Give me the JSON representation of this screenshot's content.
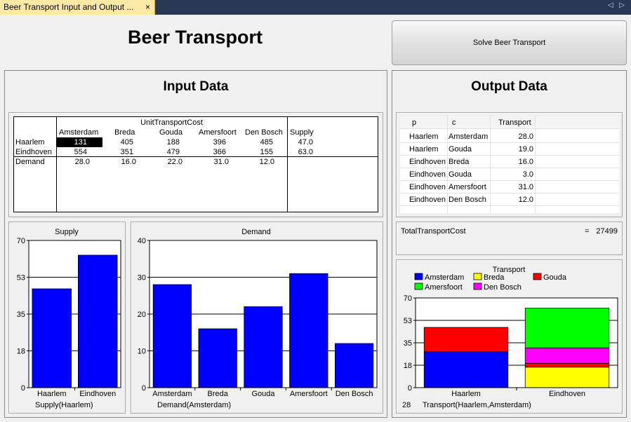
{
  "tab": {
    "title": "Beer Transport Input and Output ...",
    "close": "×",
    "nav": "◁ ▷"
  },
  "app_title": "Beer Transport",
  "solve_button": "Solve Beer Transport",
  "input_panel": {
    "title": "Input Data",
    "cost_header": "UnitTransportCost",
    "supply_header": "Supply",
    "destinations": [
      "Amsterdam",
      "Breda",
      "Gouda",
      "Amersfoort",
      "Den Bosch"
    ],
    "rows": [
      {
        "name": "Haarlem",
        "costs": [
          "131",
          "405",
          "188",
          "396",
          "485"
        ],
        "supply": "47.0"
      },
      {
        "name": "Eindhoven",
        "costs": [
          "554",
          "351",
          "479",
          "366",
          "155"
        ],
        "supply": "63.0"
      }
    ],
    "demand_label": "Demand",
    "demand": [
      "28.0",
      "16.0",
      "22.0",
      "31.0",
      "12.0"
    ]
  },
  "output_panel": {
    "title": "Output Data",
    "columns": [
      "p",
      "c",
      "Transport"
    ],
    "rows": [
      [
        "Haarlem",
        "Amsterdam",
        "28.0"
      ],
      [
        "Haarlem",
        "Gouda",
        "19.0"
      ],
      [
        "Eindhoven",
        "Breda",
        "16.0"
      ],
      [
        "Eindhoven",
        "Gouda",
        "3.0"
      ],
      [
        "Eindhoven",
        "Amersfoort",
        "31.0"
      ],
      [
        "Eindhoven",
        "Den Bosch",
        "12.0"
      ]
    ],
    "total_label": "TotalTransportCost",
    "total_eq": "=",
    "total_value": "27499"
  },
  "colors": {
    "bar": "#0000ff",
    "amsterdam": "#0000ff",
    "breda": "#ffff00",
    "gouda": "#ff0000",
    "amersfoort": "#00ff00",
    "den_bosch": "#ff00ff",
    "selection": "#000000"
  },
  "chart_data": [
    {
      "type": "bar",
      "title": "Supply",
      "categories": [
        "Haarlem",
        "Eindhoven"
      ],
      "values": [
        47,
        63
      ],
      "ylim": [
        0,
        70
      ],
      "yticks": [
        "0",
        "18",
        "35",
        "53",
        "70"
      ],
      "footer": "Supply(Haarlem)",
      "grid": true
    },
    {
      "type": "bar",
      "title": "Demand",
      "categories": [
        "Amsterdam",
        "Breda",
        "Gouda",
        "Amersfoort",
        "Den Bosch"
      ],
      "values": [
        28,
        16,
        22,
        31,
        12
      ],
      "ylim": [
        0,
        40
      ],
      "yticks": [
        "0",
        "10",
        "20",
        "30",
        "40"
      ],
      "footer": "Demand(Amsterdam)",
      "grid": true
    },
    {
      "type": "bar",
      "stacked": true,
      "title": "Transport",
      "categories": [
        "Haarlem",
        "Eindhoven"
      ],
      "series": [
        {
          "name": "Amsterdam",
          "values": [
            28,
            0
          ]
        },
        {
          "name": "Breda",
          "values": [
            0,
            16
          ]
        },
        {
          "name": "Gouda",
          "values": [
            19,
            3
          ]
        },
        {
          "name": "Amersfoort",
          "values": [
            0,
            31
          ]
        },
        {
          "name": "Den Bosch",
          "values": [
            0,
            12
          ]
        }
      ],
      "ylim": [
        0,
        70
      ],
      "yticks": [
        "0",
        "18",
        "35",
        "53",
        "70"
      ],
      "legend": "top",
      "footer_value": "28",
      "footer": "Transport(Haarlem,Amsterdam)",
      "grid": true
    }
  ]
}
